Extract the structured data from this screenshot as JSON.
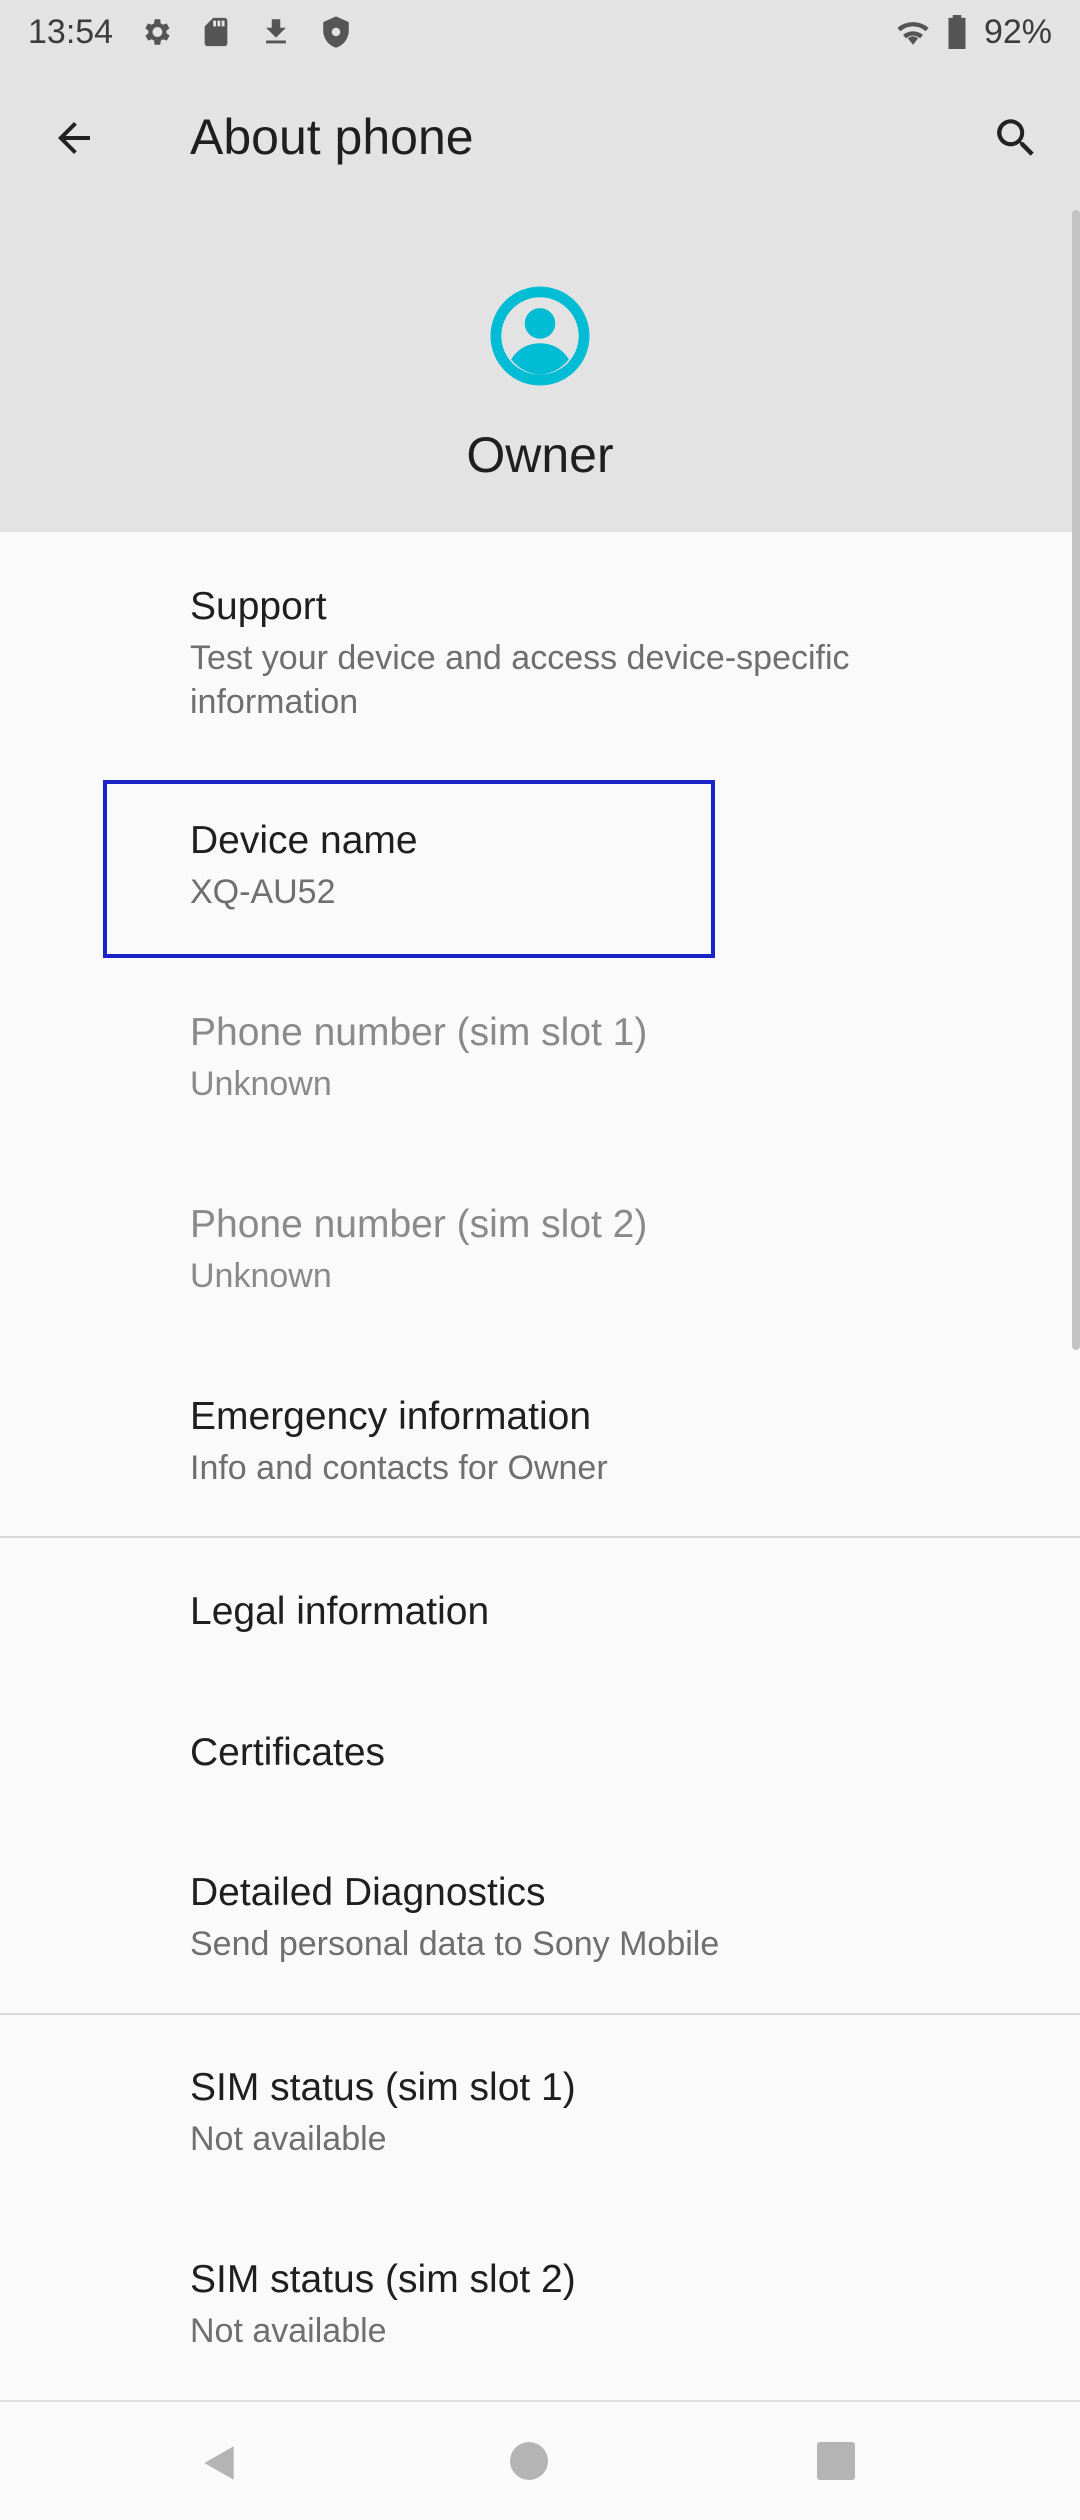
{
  "status_bar": {
    "time": "13:54",
    "battery": "92%",
    "icons": [
      "settings-icon",
      "sd-card-icon",
      "download-icon",
      "shield-icon",
      "wifi-icon",
      "battery-icon"
    ]
  },
  "app_bar": {
    "title": "About phone",
    "back_icon": "arrow-back-icon",
    "search_icon": "search-icon"
  },
  "header": {
    "owner_name": "Owner",
    "avatar_color": "#00bcd4"
  },
  "items": [
    {
      "title": "Support",
      "subtitle": "Test your device and access device-specific information",
      "enabled": true
    },
    {
      "title": "Device name",
      "subtitle": "XQ-AU52",
      "enabled": true
    },
    {
      "title": "Phone number (sim slot 1)",
      "subtitle": "Unknown",
      "enabled": false
    },
    {
      "title": "Phone number (sim slot 2)",
      "subtitle": "Unknown",
      "enabled": false
    },
    {
      "title": "Emergency information",
      "subtitle": "Info and contacts for Owner",
      "enabled": true
    },
    {
      "title": "Legal information",
      "subtitle": "",
      "enabled": true
    },
    {
      "title": "Certificates",
      "subtitle": "",
      "enabled": true
    },
    {
      "title": "Detailed Diagnostics",
      "subtitle": "Send personal data to Sony Mobile",
      "enabled": true
    },
    {
      "title": "SIM status (sim slot 1)",
      "subtitle": "Not available",
      "enabled": true
    },
    {
      "title": "SIM status (sim slot 2)",
      "subtitle": "Not available",
      "enabled": true
    }
  ],
  "highlight_color": "#1a23c8",
  "nav_bar": {
    "icons": [
      "nav-back-icon",
      "nav-home-icon",
      "nav-recents-icon"
    ]
  }
}
